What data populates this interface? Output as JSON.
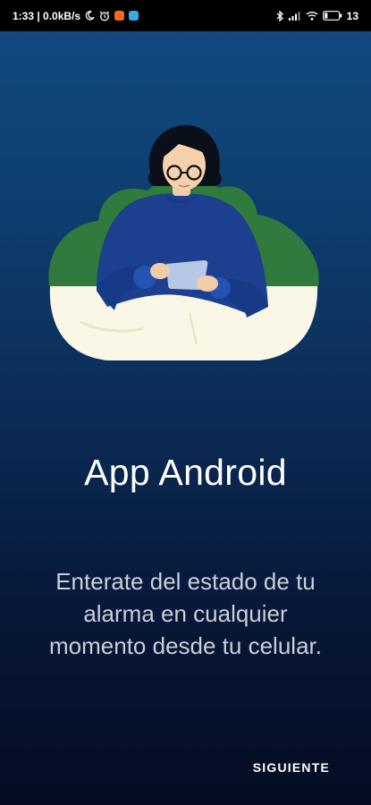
{
  "status_bar": {
    "time_net": "1:33 | 0.0kB/s",
    "battery": "13",
    "icons": [
      "moon-icon",
      "alarm-clock-icon",
      "orange-app-icon",
      "blue-app-icon",
      "bluetooth-icon",
      "signal-icon",
      "wifi-icon",
      "battery-icon"
    ]
  },
  "onboarding": {
    "illustration": "person-using-tablet-illustration",
    "title": "App Android",
    "description": "Enterate del estado de tu alarma en cualquier momento desde tu celular.",
    "next_label": "SIGUIENTE"
  },
  "colors": {
    "bg_top": "#124b83",
    "bg_bottom": "#050c22",
    "illustration_green": "#2f7a3c",
    "illustration_blue": "#1c3f8f",
    "illustration_cream": "#fbf7e6"
  }
}
